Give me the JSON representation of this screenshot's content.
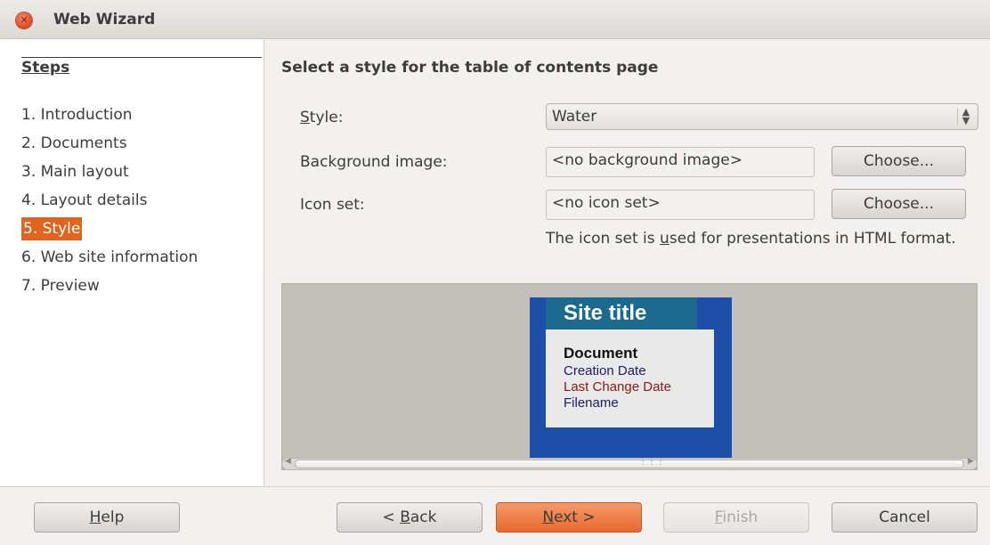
{
  "window": {
    "title": "Web Wizard"
  },
  "steps": {
    "title": "Steps",
    "items": [
      {
        "label": "1. Introduction"
      },
      {
        "label": "2. Documents"
      },
      {
        "label": "3. Main layout"
      },
      {
        "label": "4. Layout details"
      },
      {
        "label": "5. Style"
      },
      {
        "label": "6. Web site information"
      },
      {
        "label": "7. Preview"
      }
    ],
    "active_index": 4
  },
  "main": {
    "heading": "Select a style for the table of contents page",
    "style": {
      "label_prefix": "",
      "label_accel": "S",
      "label_rest": "tyle:",
      "value": "Water"
    },
    "background_image": {
      "label": "Background image:",
      "value": "<no background image>",
      "button": "Choose..."
    },
    "icon_set": {
      "label": "Icon set:",
      "value": "<no icon set>",
      "button": "Choose..."
    },
    "hint": {
      "before": "The icon set is ",
      "accel": "u",
      "after": "sed for presentations in HTML format."
    }
  },
  "preview": {
    "site_title": "Site title",
    "document": "Document",
    "creation_date": "Creation Date",
    "last_change_date": "Last Change Date",
    "filename": "Filename",
    "colors": {
      "page": "#1e4fa8",
      "title_bar": "#1b6a8e",
      "content": "#e9e9e9"
    }
  },
  "footer": {
    "help": {
      "accel": "H",
      "rest": "elp"
    },
    "back": {
      "prefix": "< ",
      "accel": "B",
      "rest": "ack"
    },
    "next": {
      "accel": "N",
      "rest": "ext >"
    },
    "finish": {
      "accel": "F",
      "rest": "inish"
    },
    "cancel": "Cancel"
  },
  "accent_color": "#e0641e"
}
